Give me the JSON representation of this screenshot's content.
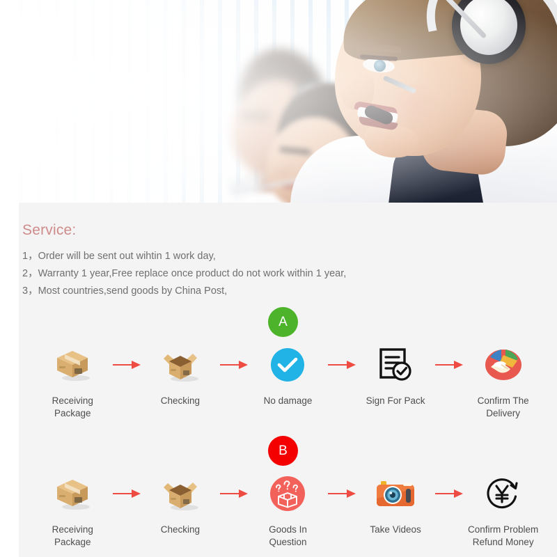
{
  "hero": {
    "alt": "call-center-agents-photo",
    "subjects": [
      "woman-with-headset-foreground",
      "man-with-headset-midground",
      "person-background"
    ]
  },
  "service": {
    "title": "Service:",
    "lines": [
      "1，Order will be sent out wihtin 1 work day,",
      "2，Warranty 1 year,Free replace once product do not work within 1 year,",
      "3，Most countries,send goods by China Post,"
    ]
  },
  "colors": {
    "accent_rose": "#cf8b8b",
    "arrow_red": "#ee4b42",
    "badge_a_green": "#4cb32b",
    "badge_b_red": "#f40000",
    "panel_bg": "#f4f4f4",
    "label_text": "#4e4e4e"
  },
  "flows": [
    {
      "id": "flow-a",
      "badge": "A",
      "badge_color": "#4cb32b",
      "steps": [
        {
          "label": "Receiving Package",
          "icon": "closed-box-icon"
        },
        {
          "label": "Checking",
          "icon": "open-box-icon"
        },
        {
          "label": "No damage",
          "icon": "blue-check-circle-icon"
        },
        {
          "label": "Sign For Pack",
          "icon": "signed-document-icon"
        },
        {
          "label": "Confirm The Delivery",
          "icon": "handshake-circle-icon"
        }
      ]
    },
    {
      "id": "flow-b",
      "badge": "B",
      "badge_color": "#f40000",
      "steps": [
        {
          "label": "Receiving Package",
          "icon": "closed-box-icon"
        },
        {
          "label": "Checking",
          "icon": "open-box-icon"
        },
        {
          "label": "Goods In Question",
          "icon": "question-box-circle-icon"
        },
        {
          "label": "Take Videos",
          "icon": "camera-icon"
        },
        {
          "label": "Confirm Problem\nRefund Money",
          "icon": "yen-refund-icon"
        }
      ]
    }
  ]
}
